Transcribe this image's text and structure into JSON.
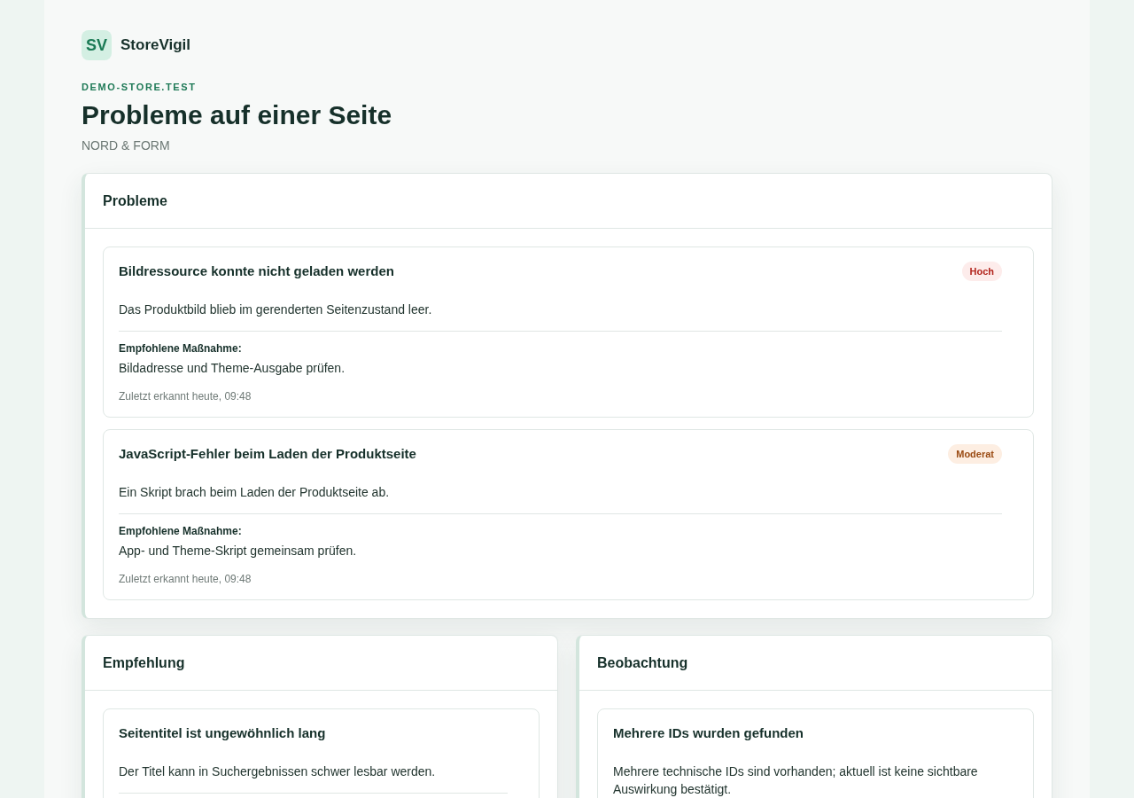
{
  "brand": {
    "logo_text": "SV",
    "name": "StoreVigil"
  },
  "store": "DEMO-STORE.TEST",
  "title": "Probleme auf einer Seite",
  "subtitle": "NORD & FORM",
  "rows": [
    [
      {
        "title": "Probleme",
        "issues": [
          {
            "title": "Bildressource konnte nicht geladen werden",
            "severity": {
              "label": "Hoch",
              "kind": "high"
            },
            "description": "Das Produktbild blieb im gerenderten Seitenzustand leer.",
            "action_label": "Empfohlene Maßnahme:",
            "action": "Bildadresse und Theme-Ausgabe prüfen.",
            "detected": "Zuletzt erkannt heute, 09:48"
          },
          {
            "title": "JavaScript-Fehler beim Laden der Produktseite",
            "severity": {
              "label": "Moderat",
              "kind": "moderate"
            },
            "description": "Ein Skript brach beim Laden der Produktseite ab.",
            "action_label": "Empfohlene Maßnahme:",
            "action": "App- und Theme-Skript gemeinsam prüfen.",
            "detected": "Zuletzt erkannt heute, 09:48"
          }
        ]
      }
    ],
    [
      {
        "title": "Empfehlung",
        "issues": [
          {
            "title": "Seitentitel ist ungewöhnlich lang",
            "description": "Der Titel kann in Suchergebnissen schwer lesbar werden."
          }
        ]
      },
      {
        "title": "Beobachtung",
        "issues": [
          {
            "title": "Mehrere IDs wurden gefunden",
            "description": "Mehrere technische IDs sind vorhanden; aktuell ist keine sichtbare Auswirkung bestätigt."
          }
        ]
      }
    ]
  ]
}
